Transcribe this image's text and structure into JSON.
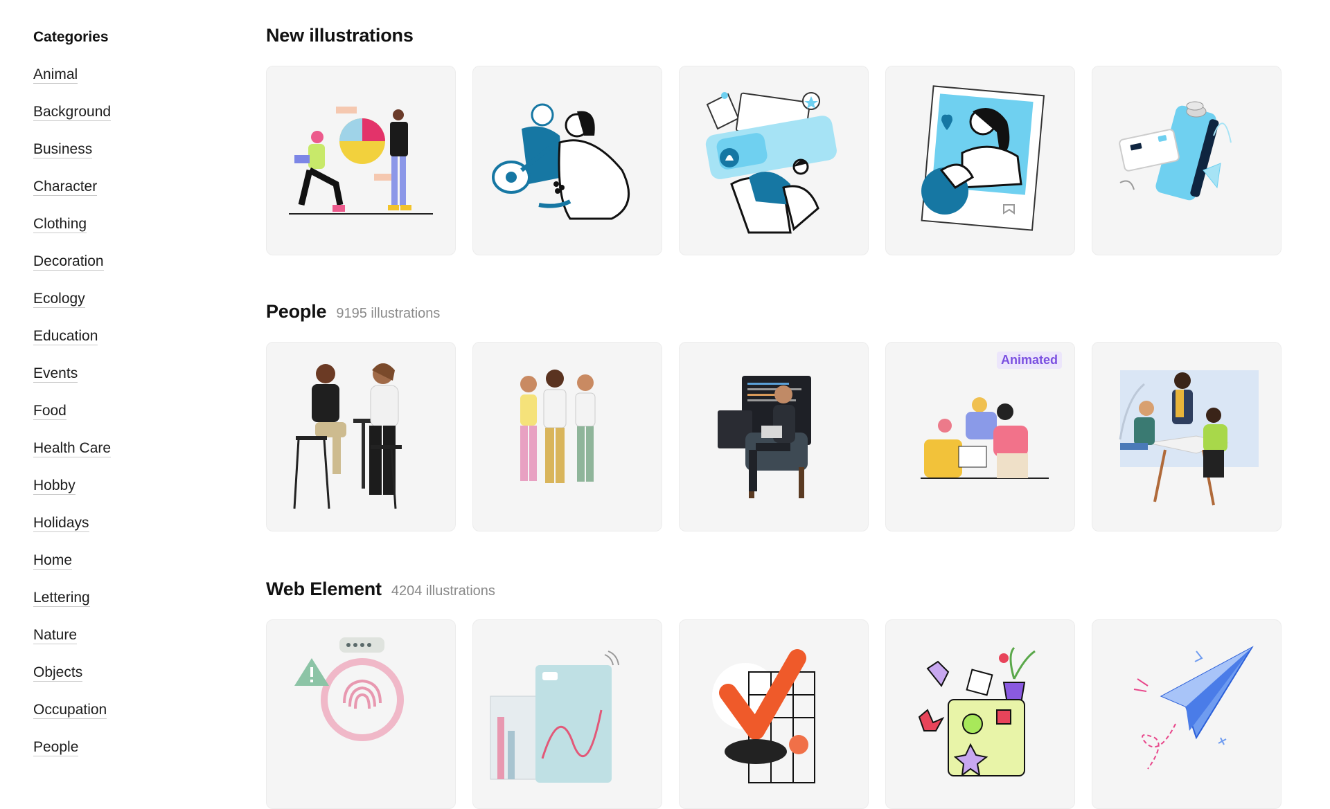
{
  "sidebar": {
    "title": "Categories",
    "items": [
      {
        "label": "Animal"
      },
      {
        "label": "Background"
      },
      {
        "label": "Business"
      },
      {
        "label": "Character"
      },
      {
        "label": "Clothing"
      },
      {
        "label": "Decoration"
      },
      {
        "label": "Ecology"
      },
      {
        "label": "Education"
      },
      {
        "label": "Events"
      },
      {
        "label": "Food"
      },
      {
        "label": "Health Care"
      },
      {
        "label": "Hobby"
      },
      {
        "label": "Holidays"
      },
      {
        "label": "Home"
      },
      {
        "label": "Lettering"
      },
      {
        "label": "Nature"
      },
      {
        "label": "Objects"
      },
      {
        "label": "Occupation"
      },
      {
        "label": "People"
      }
    ]
  },
  "sections": [
    {
      "title": "New illustrations",
      "count": ""
    },
    {
      "title": "People",
      "count": "9195 illustrations",
      "badge": "Animated"
    },
    {
      "title": "Web Element",
      "count": "4204 illustrations"
    }
  ],
  "colors": {
    "accent_badge_bg": "#ece6fb",
    "accent_badge_text": "#7a4fe0",
    "card_bg": "#f5f5f5",
    "teal": "#1677a3",
    "sky": "#6fd0f0"
  }
}
